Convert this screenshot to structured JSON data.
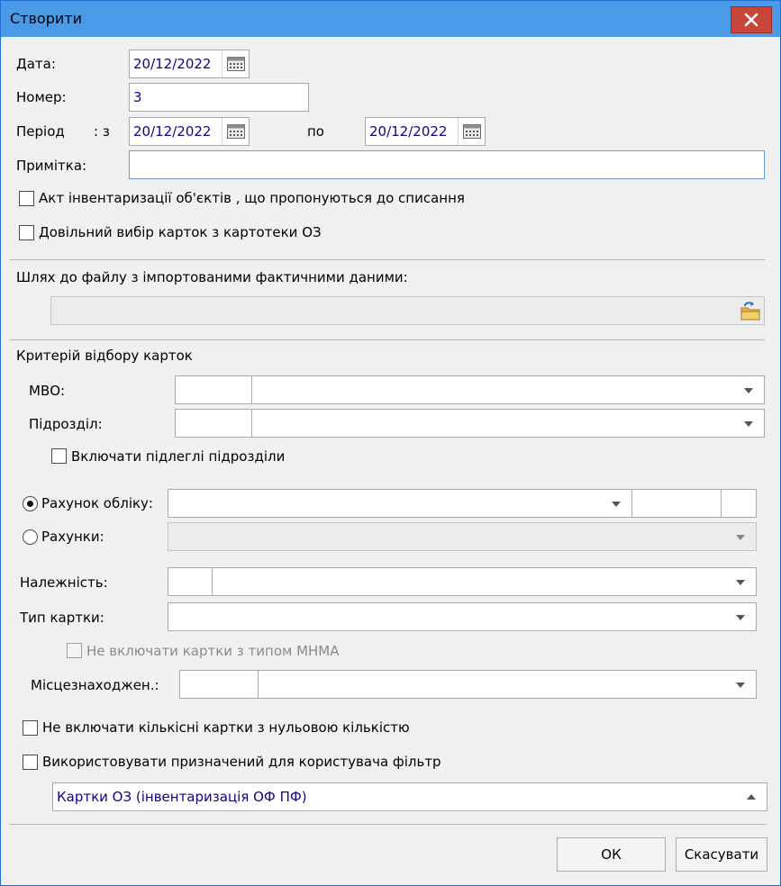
{
  "window": {
    "title": "Створити"
  },
  "form": {
    "date_label": "Дата:",
    "date_value": "20/12/2022",
    "number_label": "Номер:",
    "number_value": "3",
    "period_label": "Період",
    "period_from_label": ": з",
    "period_from_value": "20/12/2022",
    "period_to_label": "по",
    "period_to_value": "20/12/2022",
    "note_label": "Примітка:",
    "note_value": "",
    "cb_act_label": "Акт інвентаризації об'єктів , що пропонуються до списання",
    "cb_act_checked": false,
    "cb_free_label": "Довільний вибір карток з картотеки ОЗ",
    "cb_free_checked": false,
    "import_path_label": "Шлях до файлу з імпортованими фактичними даними:",
    "import_path_value": ""
  },
  "criteria": {
    "section_label": "Критерій відбору карток",
    "mvo_label": "МВО:",
    "subdivision_label": "Підрозділ:",
    "cb_subordinate_label": "Включати підлеглі підрозділи",
    "radio_account_label": "Рахунок обліку:",
    "radio_account_selected": true,
    "radio_accounts_label": "Рахунки:",
    "radio_accounts_selected": false,
    "belonging_label": "Належність:",
    "card_type_label": "Тип картки:",
    "cb_mhma_label": "Не включати картки з типом МНМА",
    "location_label": "Місцезнаходжен.:",
    "cb_zero_qty_label": "Не включати кількісні картки з нульовою кількістю",
    "cb_user_filter_label": "Використовувати призначений для користувача фільтр",
    "filter_value": "Картки ОЗ (інвентаризація ОФ ПФ)"
  },
  "buttons": {
    "ok": "ОК",
    "cancel": "Скасувати"
  },
  "icons": [
    "close-icon",
    "calendar-icon",
    "folder-open-icon",
    "chevron-down-icon",
    "chevron-up-icon"
  ],
  "colors": {
    "titlebar": "#4a9ae8",
    "close": "#c8453a",
    "value_text": "#16008a",
    "dialog_bg": "#f0f0f0"
  }
}
